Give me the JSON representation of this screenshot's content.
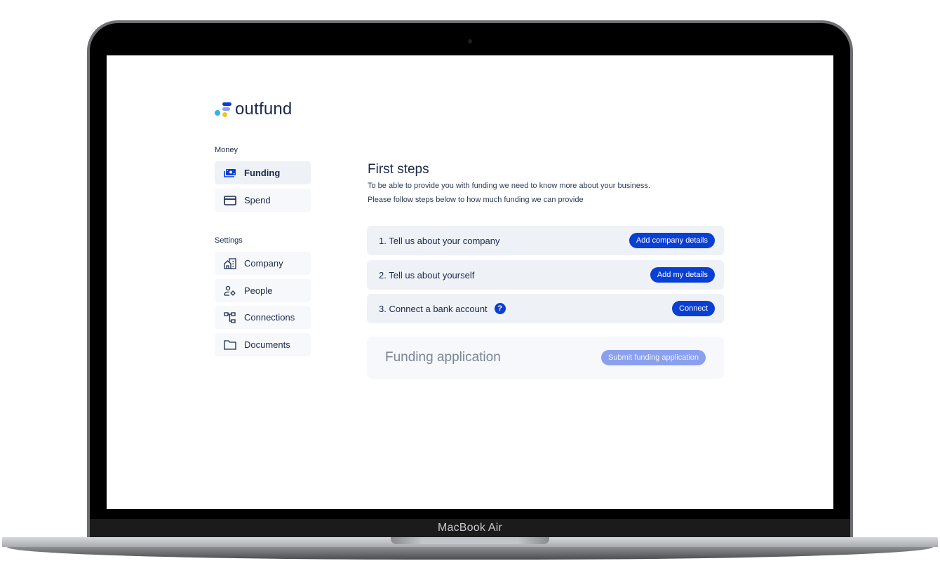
{
  "device": {
    "label": "MacBook Air"
  },
  "app": {
    "brand": "outfund",
    "colors": {
      "primary": "#0a3fd4",
      "primary_disabled": "#8aa0ee",
      "text": "#1b2a4a",
      "card_bg": "#eef1f6"
    }
  },
  "sidebar": {
    "sections": [
      {
        "label": "Money",
        "items": [
          {
            "label": "Funding",
            "icon": "banknote-icon",
            "active": true
          },
          {
            "label": "Spend",
            "icon": "credit-card-icon",
            "active": false
          }
        ]
      },
      {
        "label": "Settings",
        "items": [
          {
            "label": "Company",
            "icon": "building-icon",
            "active": false
          },
          {
            "label": "People",
            "icon": "user-settings-icon",
            "active": false
          },
          {
            "label": "Connections",
            "icon": "connections-icon",
            "active": false
          },
          {
            "label": "Documents",
            "icon": "folder-icon",
            "active": false
          }
        ]
      }
    ]
  },
  "main": {
    "title": "First steps",
    "subtitle_lines": [
      "To be able to provide you with funding we need to know more about your business.",
      "Please follow  steps below to how much funding we can provide"
    ],
    "steps": [
      {
        "label": "1. Tell us about your company",
        "button": "Add company details",
        "has_help": false
      },
      {
        "label": "2. Tell us about yourself",
        "button": "Add my details",
        "has_help": false
      },
      {
        "label": "3. Connect a bank account",
        "button": "Connect",
        "has_help": true,
        "help_glyph": "?"
      }
    ],
    "application": {
      "title": "Funding application",
      "button": "Submit funding application",
      "button_disabled": true
    }
  }
}
